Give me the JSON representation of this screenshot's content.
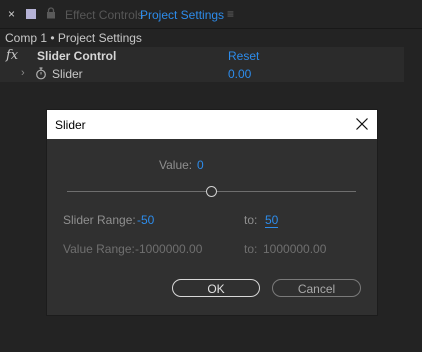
{
  "tabs": {
    "close_glyph": "×",
    "inactive_label": "Effect Controls",
    "active_label": "Project Settings",
    "menu_glyph": "≡",
    "swatch_color": "#b5b2d6",
    "active_color": "#2d8ceb"
  },
  "breadcrumb": "Comp 1 • Project Settings",
  "effect": {
    "fx_glyph": "fx",
    "name": "Slider Control",
    "reset_label": "Reset",
    "property": {
      "name": "Slider",
      "value": "0.00"
    }
  },
  "dialog": {
    "title": "Slider",
    "value_label": "Value:",
    "value": "0",
    "slider_fraction": 0.5,
    "slider_range_label": "Slider Range:",
    "slider_range_min": "-50",
    "slider_range_to": "to:",
    "slider_range_max": "50",
    "value_range_label": "Value Range:",
    "value_range_min": "-1000000.00",
    "value_range_to": "to:",
    "value_range_max": "1000000.00",
    "ok_label": "OK",
    "cancel_label": "Cancel"
  }
}
